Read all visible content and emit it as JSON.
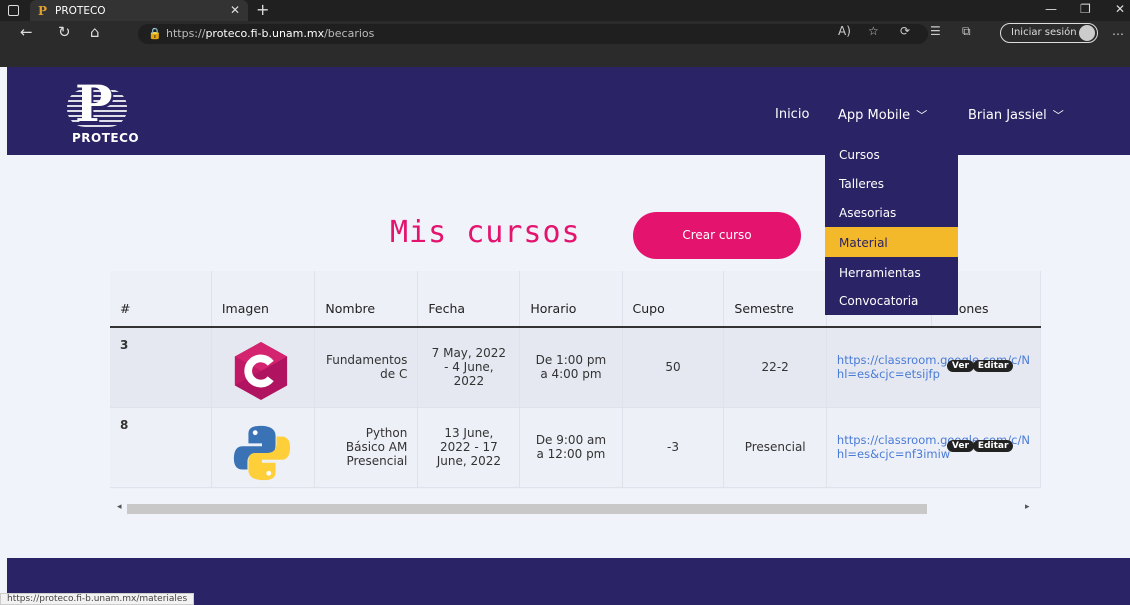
{
  "browser": {
    "tab_title": "PROTECO",
    "tab_favicon": "P",
    "url_scheme": "https://",
    "url_host": "proteco.fi-b.unam.mx",
    "url_path": "/becarios",
    "signin_label": "Iniciar sesión",
    "status_url": "https://proteco.fi-b.unam.mx/materiales"
  },
  "header": {
    "logo_text": "PROTECO",
    "nav": {
      "inicio": "Inicio",
      "app_mobile": "App Mobile",
      "user": "Brian Jassiel"
    },
    "dropdown": [
      "Cursos",
      "Talleres",
      "Asesorias",
      "Material",
      "Herramientas",
      "Convocatoria"
    ],
    "dropdown_active": "Material"
  },
  "main": {
    "title": "Mis cursos",
    "create_button": "Crear curso",
    "table": {
      "columns": [
        "#",
        "Imagen",
        "Nombre",
        "Fecha",
        "Horario",
        "Cupo",
        "Semestre",
        "",
        "ciones"
      ],
      "rows": [
        {
          "id": "3",
          "image": "c-language-logo",
          "nombre": "Fundamentos de C",
          "fecha": "7 May, 2022 - 4 June, 2022",
          "horario": "De 1:00 pm a 4:00 pm",
          "cupo": "50",
          "semestre": "22-2",
          "link": "https://classroom.google.com/c/N",
          "link2": "hl=es&cjc=etsijfp",
          "ver": "Ver",
          "editar": "Editar"
        },
        {
          "id": "8",
          "image": "python-logo",
          "nombre": "Python Básico AM Presencial",
          "fecha": "13 June, 2022 - 17 June, 2022",
          "horario": "De 9:00 am a 12:00 pm",
          "cupo": "-3",
          "semestre": "Presencial",
          "link": "https://classroom.google.com/c/N",
          "link2": "hl=es&cjc=nf3imiw",
          "ver": "Ver",
          "editar": "Editar"
        }
      ]
    }
  },
  "colors": {
    "brand_navy": "#2a2365",
    "accent_pink": "#e3136e",
    "dropdown_active": "#f4b92b",
    "link": "#4a7bd6"
  }
}
